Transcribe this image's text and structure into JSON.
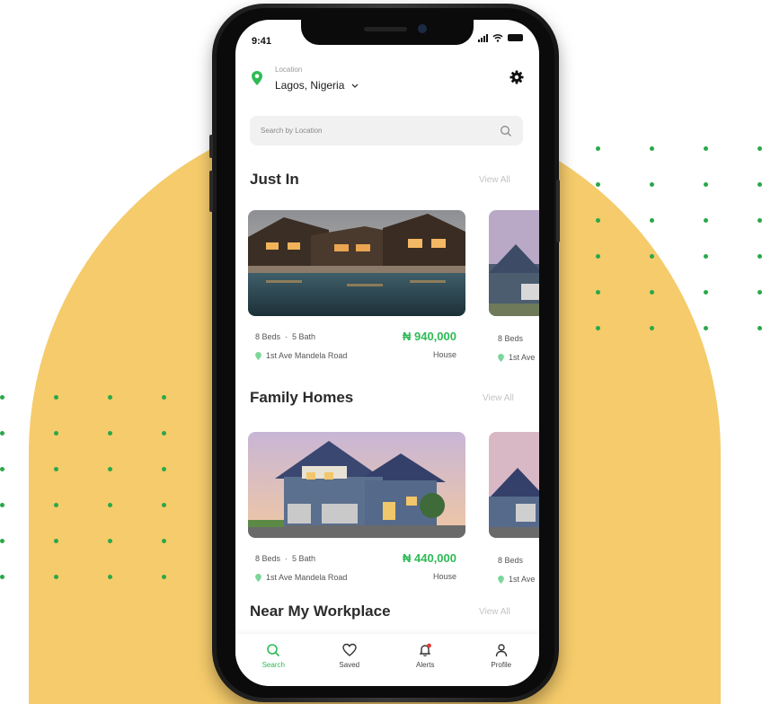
{
  "status_bar": {
    "time": "9:41"
  },
  "location": {
    "label": "Location",
    "value": "Lagos, Nigeria"
  },
  "search": {
    "placeholder": "Search by Location"
  },
  "sections": [
    {
      "title": "Just In",
      "view_all": "View All",
      "card": {
        "beds": "8 Beds",
        "baths": "5 Bath",
        "price": "₦ 940,000",
        "address": "1st Ave Mandela Road",
        "type": "House"
      },
      "peek": {
        "beds": "8 Beds",
        "address": "1st Ave"
      }
    },
    {
      "title": "Family Homes",
      "view_all": "View All",
      "card": {
        "beds": "8 Beds",
        "baths": "5 Bath",
        "price": "₦ 440,000",
        "address": "1st Ave Mandela Road",
        "type": "House"
      },
      "peek": {
        "beds": "8 Beds",
        "address": "1st Ave"
      }
    },
    {
      "title": "Near My Workplace",
      "view_all": "View All"
    }
  ],
  "nav": [
    {
      "label": "Search",
      "icon": "search-icon",
      "active": true
    },
    {
      "label": "Saved",
      "icon": "heart-icon",
      "active": false
    },
    {
      "label": "Alerts",
      "icon": "bell-icon",
      "active": false
    },
    {
      "label": "Profile",
      "icon": "user-icon",
      "active": false
    }
  ],
  "colors": {
    "accent": "#2dbb55",
    "background_blob": "#f5cb6b",
    "dots": "#2aa84a",
    "alert_dot": "#e53935"
  }
}
